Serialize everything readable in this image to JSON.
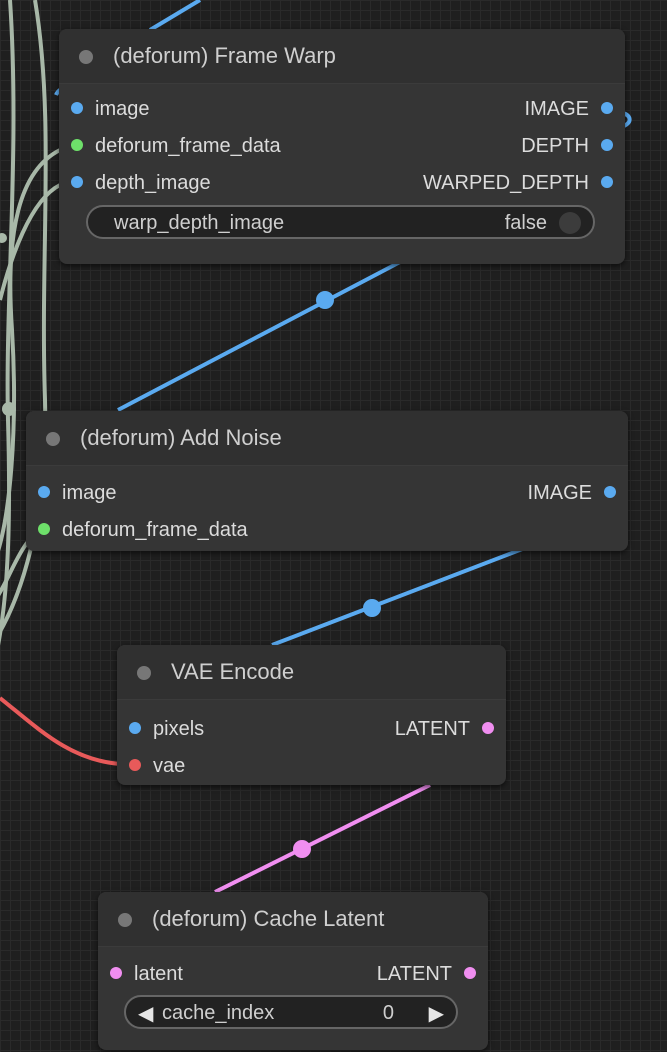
{
  "colors": {
    "background": "#1f1f1f",
    "node_body": "#353535",
    "node_title": "#303030",
    "image_wire": "#5aaaf0",
    "frame_data_slot": "#6ee06a",
    "vae_slot": "#e85a5a",
    "latent_slot": "#f08ef0",
    "gray_wire": "#a8b8a8"
  },
  "nodes": {
    "frame_warp": {
      "title": "(deforum) Frame Warp",
      "inputs": [
        "image",
        "deforum_frame_data",
        "depth_image"
      ],
      "outputs": [
        "IMAGE",
        "DEPTH",
        "WARPED_DEPTH"
      ],
      "widget": {
        "label": "warp_depth_image",
        "value": "false"
      }
    },
    "add_noise": {
      "title": "(deforum) Add Noise",
      "inputs": [
        "image",
        "deforum_frame_data"
      ],
      "outputs": [
        "IMAGE"
      ]
    },
    "vae_encode": {
      "title": "VAE Encode",
      "inputs": [
        "pixels",
        "vae"
      ],
      "outputs": [
        "LATENT"
      ]
    },
    "cache_latent": {
      "title": "(deforum) Cache Latent",
      "inputs": [
        "latent"
      ],
      "outputs": [
        "LATENT"
      ],
      "widget": {
        "label": "cache_index",
        "value": "0",
        "left_arrow": "◀",
        "right_arrow": "▶"
      }
    }
  }
}
